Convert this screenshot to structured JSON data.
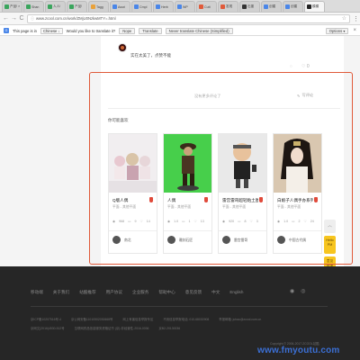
{
  "browser": {
    "tabs": [
      {
        "label": "产品! ×",
        "color": "#3aa55d",
        "active": false
      },
      {
        "label": "Shan",
        "color": "#3aa55d",
        "active": false
      },
      {
        "label": "人人!",
        "color": "#3aa55d",
        "active": false
      },
      {
        "label": "产品!",
        "color": "#3aa55d",
        "active": false
      },
      {
        "label": "Tagg",
        "color": "#e9a23b",
        "active": false
      },
      {
        "label": "Assri",
        "color": "#4a86e8",
        "active": false
      },
      {
        "label": "Cmpl",
        "color": "#4a86e8",
        "active": false
      },
      {
        "label": "Herb",
        "color": "#4a86e8",
        "active": false
      },
      {
        "label": "WP",
        "color": "#4a86e8",
        "active": false
      },
      {
        "label": "Cutt",
        "color": "#e05a3a",
        "active": false
      },
      {
        "label": "发现",
        "color": "#e05a3a",
        "active": false
      },
      {
        "label": "石墨",
        "color": "#333333",
        "active": false
      },
      {
        "label": "创建",
        "color": "#4a86e8",
        "active": false
      },
      {
        "label": "创建",
        "color": "#4a86e8",
        "active": false
      },
      {
        "label": "模模",
        "color": "#222222",
        "active": true
      }
    ],
    "url": "www.zcool.com.cn/work/ZMjU0NzkwMTY=.html",
    "nav": {
      "back": "←",
      "forward": "→",
      "reload": "C"
    }
  },
  "translate_bar": {
    "prefix": "This page is in",
    "language": "Chinese ↓",
    "question": "Would you like to translate it?",
    "btn_nope": "Nope",
    "btn_translate": "Translate",
    "btn_never": "Never translate Chinese (Simplified)",
    "options": "Options ▾",
    "close": "×"
  },
  "comment": {
    "text": "实在太美了，点赞不能",
    "like_count": "0"
  },
  "reviews": {
    "no_more": "没有更多评论了",
    "write": "写评论"
  },
  "recommend": {
    "title": "你可能喜欢",
    "cards": [
      {
        "name": "Q版人偶",
        "sub": "平面 - 其他平面",
        "views": "968",
        "comments": "9",
        "likes": "14",
        "author": "南北",
        "img_bg": "#f1eef0"
      },
      {
        "name": "人偶",
        "sub": "平面 - 其他平面",
        "views": "1.0",
        "comments": "1",
        "likes": "13",
        "author": "雕刻石匠",
        "img_bg": "#47cf4b"
      },
      {
        "name": "雷宫雷哥超轻粘土图",
        "sub": "平面 - 其他平面",
        "views": "920",
        "comments": "8",
        "likes": "3",
        "author": "雷宫雷哥",
        "img_bg": "#e9e9e9"
      },
      {
        "name": "白娘子人偶手办系列",
        "sub": "平面 - 其他平面",
        "views": "1.0",
        "comments": "2",
        "likes": "24",
        "author": "中国古代偶",
        "img_bg": "#d9c7b0"
      }
    ]
  },
  "side": {
    "top": "︿",
    "hello": "Hello\nPM",
    "fb": "意见\n反馈"
  },
  "footer": {
    "nav": [
      "移动端",
      "关于我们",
      "站酷推荐",
      "用户协议",
      "企业服务",
      "帮助中心",
      "意见反馈",
      "中文",
      "English"
    ],
    "row1": [
      "京ICP备10207516号-4",
      "京公网安备11010502030668号",
      "网上有害信息举报专区",
      "不良信息举报电话: 010-68030908",
      "举报邮箱: jubao@zcool.com.cn"
    ],
    "row2": [
      "京网文(2016)4530-512号",
      "互联网药品信息服务资格证书 (京)-非经营性-2016-0036",
      "京B2-20130036"
    ],
    "copyright": "Copyright © 2006-2017 ZCOOL站酷"
  },
  "watermark": "www.fmyoutu.com"
}
